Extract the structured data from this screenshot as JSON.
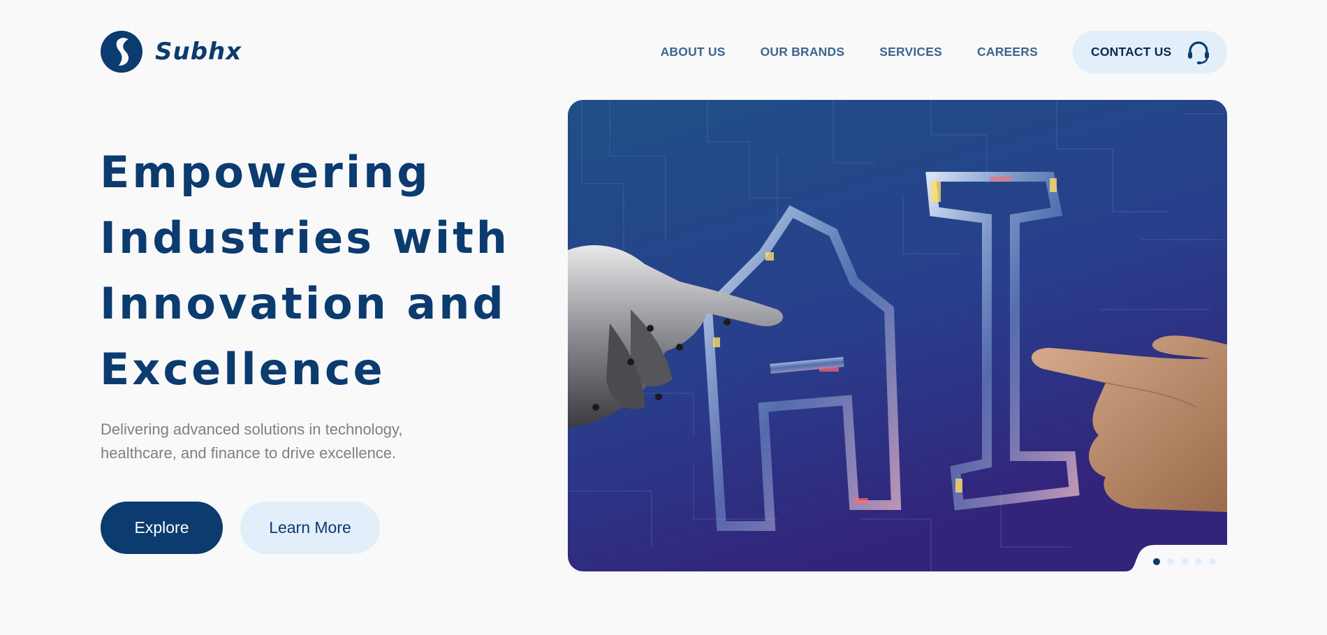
{
  "brand": {
    "name": "Subhx"
  },
  "nav": {
    "items": [
      {
        "label": "ABOUT US"
      },
      {
        "label": "OUR BRANDS"
      },
      {
        "label": "SERVICES"
      },
      {
        "label": "CAREERS"
      }
    ],
    "contact_label": "CONTACT US",
    "contact_icon": "headset-icon"
  },
  "hero": {
    "title_lines": [
      "Empowering",
      "Industries with",
      "Innovation and",
      "Excellence"
    ],
    "subtitle_lines": [
      "Delivering advanced solutions in technology,",
      "healthcare, and finance to drive excellence."
    ],
    "primary_button": "Explore",
    "secondary_button": "Learn More"
  },
  "carousel": {
    "slide_count": 5,
    "active_slide": 1
  },
  "colors": {
    "brand": "#0b3b6f",
    "nav_text": "#3c6690",
    "light_accent": "#e2eefa",
    "page_bg": "#f9f9fa",
    "subtitle_text": "#7d7f87"
  }
}
